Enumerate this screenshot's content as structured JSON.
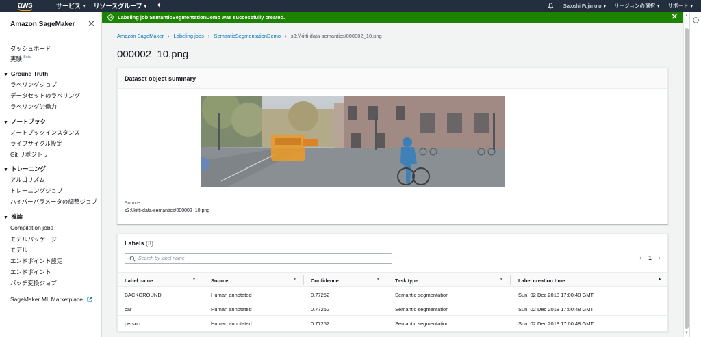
{
  "topnav": {
    "logo": "aws",
    "services": "サービス",
    "resource_groups": "リソースグループ",
    "user": "Satoshi Fujimoto",
    "region": "リージョンの選択",
    "support": "サポート"
  },
  "flash": {
    "message": "Labeling job SemanticSegmentationDemo was successfully created."
  },
  "sidebar": {
    "title": "Amazon SageMaker",
    "top_items": [
      {
        "label": "ダッシュボード"
      },
      {
        "label": "実験",
        "badge": "Beta"
      }
    ],
    "groups": [
      {
        "label": "Ground Truth",
        "items": [
          "ラベリングジョブ",
          "データセットのラベリング",
          "ラベリング労働力"
        ]
      },
      {
        "label": "ノートブック",
        "items": [
          "ノートブックインスタンス",
          "ライフサイクル設定",
          "Git リポジトリ"
        ]
      },
      {
        "label": "トレーニング",
        "items": [
          "アルゴリズム",
          "トレーニングジョブ",
          "ハイパーパラメータの調整ジョブ"
        ]
      },
      {
        "label": "推論",
        "items": [
          "Compilation jobs",
          "モデルパッケージ",
          "モデル",
          "エンドポイント設定",
          "エンドポイント",
          "バッチ変換ジョブ"
        ]
      }
    ],
    "marketplace": "SageMaker ML Marketplace"
  },
  "breadcrumb": [
    "Amazon SageMaker",
    "Labeling jobs",
    "SemanticSegmentationDemo",
    "s3://kitti-data-semantics/000002_10.png"
  ],
  "page_title": "000002_10.png",
  "summary": {
    "title": "Dataset object summary",
    "source_label": "Source",
    "source_value": "s3://kitti-data-semantics/000002_10.png"
  },
  "labels": {
    "title": "Labels",
    "count": "(3)",
    "search_placeholder": "Search by label name",
    "page": "1",
    "columns": [
      "Label name",
      "Source",
      "Confidence",
      "Task type",
      "Label creation time"
    ],
    "rows": [
      [
        "BACKGROUND",
        "Human annotated",
        "0.77252",
        "Semantic segmentation",
        "Sun, 02 Dec 2018 17:00:48 GMT"
      ],
      [
        "car",
        "Human annotated",
        "0.77252",
        "Semantic segmentation",
        "Sun, 02 Dec 2018 17:00:48 GMT"
      ],
      [
        "person",
        "Human annotated",
        "0.77252",
        "Semantic segmentation",
        "Sun, 02 Dec 2018 17:00:48 GMT"
      ]
    ]
  },
  "colors": {
    "nav_bg": "#232f3e",
    "success": "#1d8102",
    "link": "#0073bb",
    "aws_orange": "#ff9900"
  }
}
